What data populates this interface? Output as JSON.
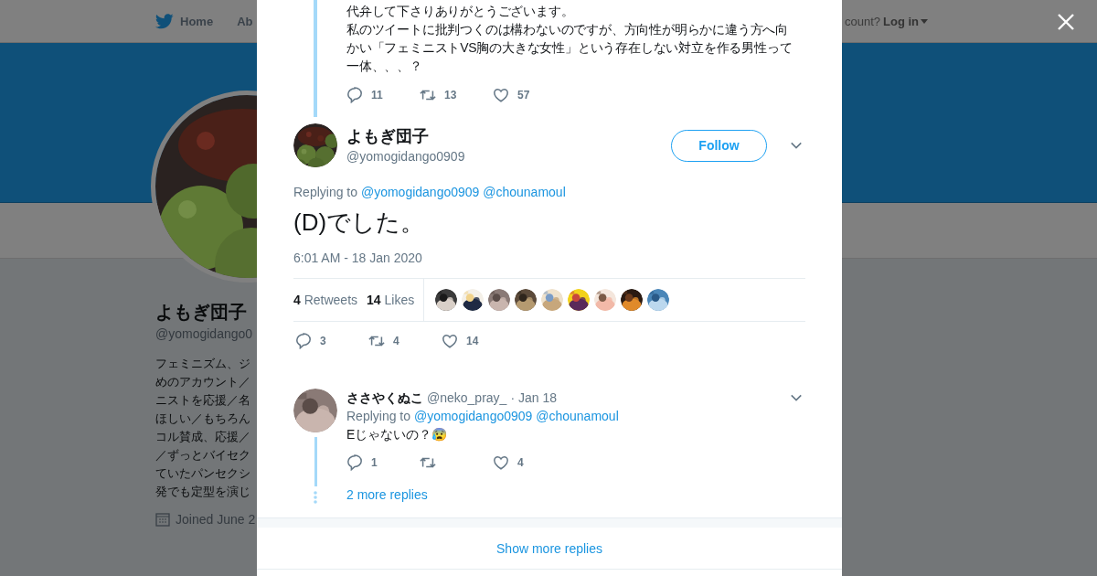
{
  "topnav": {
    "items": [
      {
        "label": "Home",
        "kind": "home"
      },
      {
        "label": "Ab",
        "kind": "link"
      }
    ],
    "account_prompt": "count?",
    "login": "Log in"
  },
  "profile": {
    "name": "よもぎ団子",
    "handle": "@yomogidango0",
    "bio_lines": [
      "フェミニズム、ジ",
      "めのアカウント／",
      "ニストを応援／名",
      "ほしい／もちろん",
      "コル賛成、応援／",
      "／ずっとバイセク",
      "ていたパンセクシ",
      "発でも定型を演じ"
    ],
    "joined": "Joined June 2"
  },
  "modal": {
    "previous_tweet": {
      "text_lines": [
        "代弁して下さりありがとうございます。",
        "私のツイートに批判つくのは構わないのですが、方向性が明らかに違う方へ向",
        "かい「フェミニストVS胸の大きな女性」という存在しない対立を作る男性って",
        "一体、、、？"
      ],
      "replies": "11",
      "retweets": "13",
      "likes": "57"
    },
    "tweet": {
      "name": "よもぎ団子",
      "handle": "@yomogidango0909",
      "follow": "Follow",
      "replying_label": "Replying to",
      "mentions": [
        "@yomogidango0909",
        "@chounamoul"
      ],
      "text": "(D)でした。",
      "time": "6:01 AM - 18 Jan 2020",
      "retweet_count": "4",
      "retweet_label": "Retweets",
      "like_count": "14",
      "like_label": "Likes",
      "replies": "3",
      "retweets": "4",
      "likes": "14"
    },
    "replies": [
      {
        "name": "ささやくぬこ",
        "handle": "@neko_pray_",
        "separator": "·",
        "date": "Jan 18",
        "replying_label": "Replying to",
        "mentions": [
          "@yomogidango0909",
          "@chounamoul"
        ],
        "text": "Eじゃないの？😰",
        "replies": "1",
        "likes": "4",
        "more_replies": "2 more replies"
      }
    ],
    "show_more": "Show more replies"
  }
}
